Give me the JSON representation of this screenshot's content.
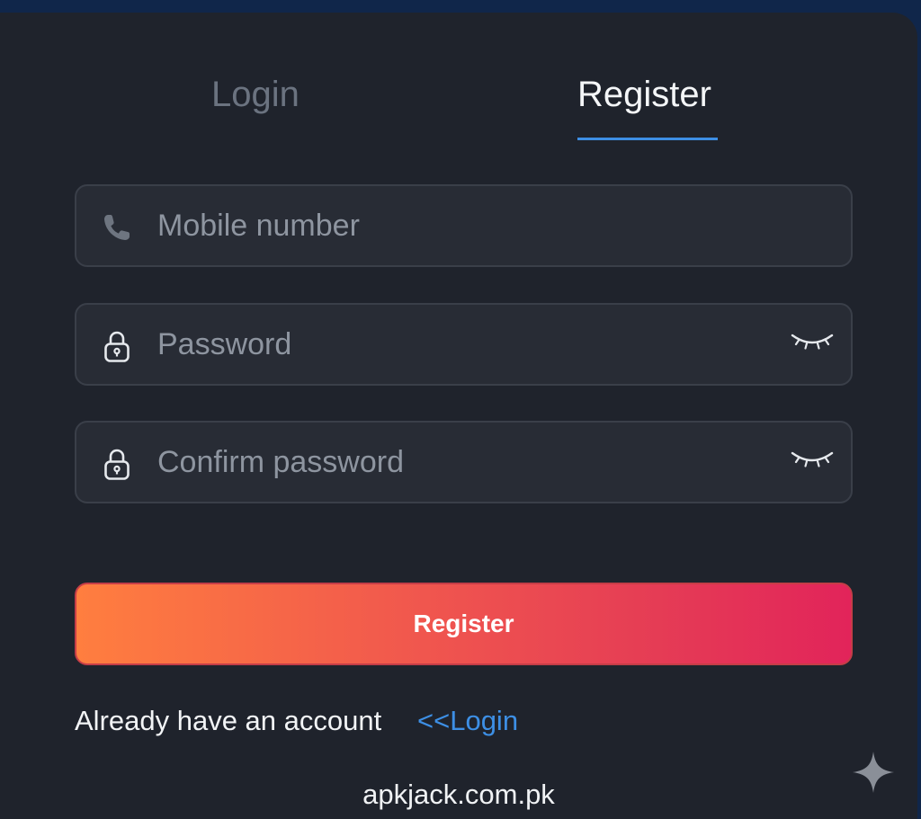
{
  "tabs": {
    "login_label": "Login",
    "register_label": "Register",
    "active": "register"
  },
  "form": {
    "mobile": {
      "placeholder": "Mobile number",
      "value": "",
      "icon": "phone-icon"
    },
    "password": {
      "placeholder": "Password",
      "value": "",
      "icon": "lock-icon",
      "toggle_icon": "eye-closed-icon"
    },
    "confirm_password": {
      "placeholder": "Confirm password",
      "value": "",
      "icon": "lock-icon",
      "toggle_icon": "eye-closed-icon"
    },
    "submit_label": "Register"
  },
  "footer": {
    "prompt": "Already have an account",
    "link_label": "<<Login"
  },
  "watermark": "apkjack.com.pk",
  "colors": {
    "background": "#1f232c",
    "page_background": "#10264a",
    "accent": "#3d8ee4",
    "button_gradient_start": "#ff7e3f",
    "button_gradient_end": "#e2245a"
  }
}
